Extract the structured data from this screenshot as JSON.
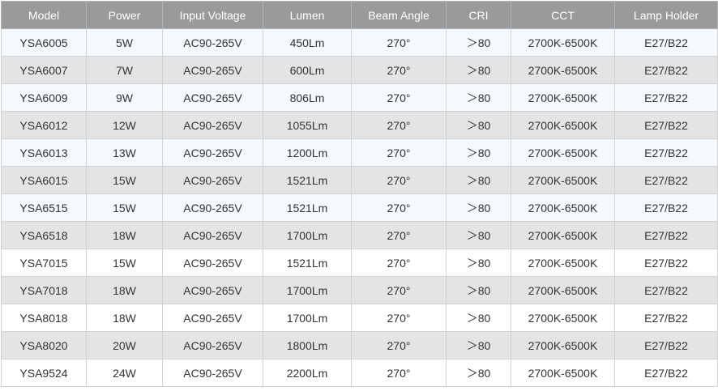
{
  "table": {
    "headers": [
      "Model",
      "Power",
      "Input Voltage",
      "Lumen",
      "Beam Angle",
      "CRI",
      "CCT",
      "Lamp Holder"
    ],
    "rows": [
      [
        "YSA6005",
        "5W",
        "AC90-265V",
        "450Lm",
        "270°",
        "＞80",
        "2700K-6500K",
        "E27/B22"
      ],
      [
        "YSA6007",
        "7W",
        "AC90-265V",
        "600Lm",
        "270°",
        "＞80",
        "2700K-6500K",
        "E27/B22"
      ],
      [
        "YSA6009",
        "9W",
        "AC90-265V",
        "806Lm",
        "270°",
        "＞80",
        "2700K-6500K",
        "E27/B22"
      ],
      [
        "YSA6012",
        "12W",
        "AC90-265V",
        "1055Lm",
        "270°",
        "＞80",
        "2700K-6500K",
        "E27/B22"
      ],
      [
        "YSA6013",
        "13W",
        "AC90-265V",
        "1200Lm",
        "270°",
        "＞80",
        "2700K-6500K",
        "E27/B22"
      ],
      [
        "YSA6015",
        "15W",
        "AC90-265V",
        "1521Lm",
        "270°",
        "＞80",
        "2700K-6500K",
        "E27/B22"
      ],
      [
        "YSA6515",
        "15W",
        "AC90-265V",
        "1521Lm",
        "270°",
        "＞80",
        "2700K-6500K",
        "E27/B22"
      ],
      [
        "YSA6518",
        "18W",
        "AC90-265V",
        "1700Lm",
        "270°",
        "＞80",
        "2700K-6500K",
        "E27/B22"
      ],
      [
        "YSA7015",
        "15W",
        "AC90-265V",
        "1521Lm",
        "270°",
        "＞80",
        "2700K-6500K",
        "E27/B22"
      ],
      [
        "YSA7018",
        "18W",
        "AC90-265V",
        "1700Lm",
        "270°",
        "＞80",
        "2700K-6500K",
        "E27/B22"
      ],
      [
        "YSA8018",
        "18W",
        "AC90-265V",
        "1700Lm",
        "270°",
        "＞80",
        "2700K-6500K",
        "E27/B22"
      ],
      [
        "YSA8020",
        "20W",
        "AC90-265V",
        "1800Lm",
        "270°",
        "＞80",
        "2700K-6500K",
        "E27/B22"
      ],
      [
        "YSA9524",
        "24W",
        "AC90-265V",
        "2200Lm",
        "270°",
        "＞80",
        "2700K-6500K",
        "E27/B22"
      ]
    ]
  },
  "colors": {
    "header_bg": "#9a9a9a",
    "header_text": "#ffffff",
    "row_light": "#f3f9fc",
    "row_gray": "#e4e4e4",
    "row_white": "#ffffff",
    "border": "#d2d2d2"
  }
}
